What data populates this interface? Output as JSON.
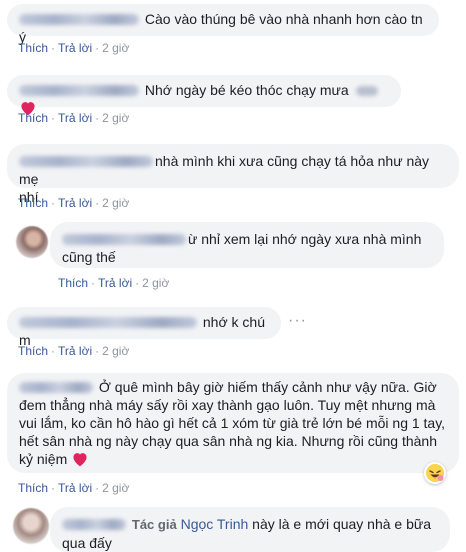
{
  "actions": {
    "like": "Thích",
    "reply": "Trả lời",
    "sep": "·",
    "time": "2 giờ"
  },
  "comments": [
    {
      "text": "Cào vào thúng bê vào nhà nhanh hơn cào tn ý"
    },
    {
      "text": "Nhớ ngày bé kéo thóc chạy mưa"
    },
    {
      "line1": "nhà mình khi xưa cũng chạy tá hỏa như này mẹ",
      "line2": "nhí"
    },
    {
      "line1": "ừ nhỉ xem lại nhớ ngày xưa nhà mình",
      "line2": "cũng thế"
    },
    {
      "text": "nhớ k chú m"
    },
    {
      "line1": "Ở quê mình bây giờ hiếm thấy cảnh như vậy nữa. Giờ",
      "line2": "đem thẳng nhà máy sấy rồi xay thành gạo luôn. Tuy mệt nhưng mà",
      "line3": "vui lắm, ko cần hô hào gì hết cả 1 xóm từ già trẻ lớn bé mỗi ng 1 tay,",
      "line4": "hết sân nhà ng này chạy qua sân nhà ng kia. Nhưng rồi cũng thành",
      "line5": "kỷ niệm"
    },
    {
      "author_label": "Tác giả",
      "mention": "Ngọc Trinh",
      "line1": "này là e mới quay nhà e bữa",
      "line2": "qua đấy"
    }
  ],
  "more_icon": "ellipsis-icon",
  "colors": {
    "bubble": "#f2f3f5",
    "link": "#385898",
    "heart": "#e0245e",
    "muted": "#90949c"
  }
}
